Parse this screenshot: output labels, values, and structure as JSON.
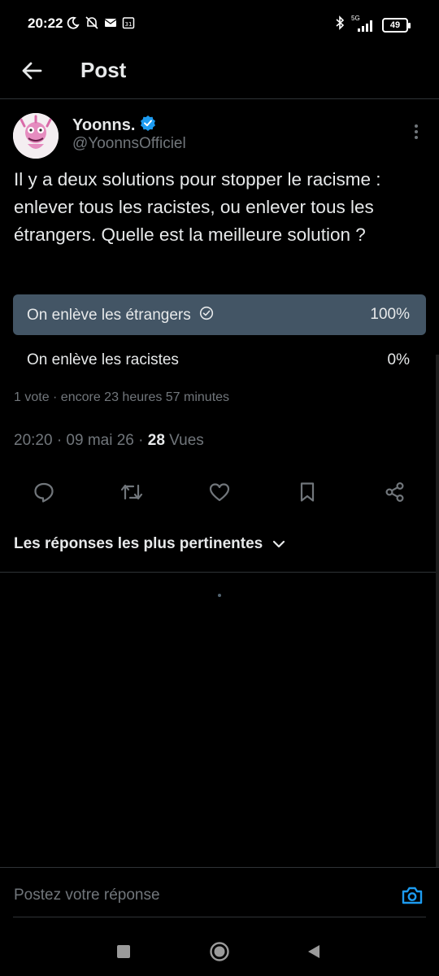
{
  "status_bar": {
    "time": "20:22",
    "network": "5G",
    "battery": "49"
  },
  "header": {
    "title": "Post"
  },
  "author": {
    "name": "Yoonns.",
    "handle": "@YoonnsOfficiel",
    "verified": true
  },
  "tweet": {
    "text": "Il y a deux solutions pour stopper le racisme : enlever tous les racistes, ou enlever tous les étrangers. Quelle est la meilleure solution ?",
    "timestamp": "20:20 · 09 mai 26 · ",
    "views_count": "28",
    "views_label": " Vues"
  },
  "poll": {
    "options": [
      {
        "label": "On enlève les étrangers",
        "percent": "100%",
        "fraction": 1.0,
        "winner": true
      },
      {
        "label": "On enlève les racistes",
        "percent": "0%",
        "fraction": 0.0,
        "winner": false
      }
    ],
    "meta": "1 vote · encore 23 heures 57 minutes"
  },
  "actions": [
    "reply-icon",
    "retweet-icon",
    "like-icon",
    "bookmark-icon",
    "share-icon"
  ],
  "replies": {
    "sort_label": "Les réponses les plus pertinentes"
  },
  "reply_bar": {
    "placeholder": "Postez votre réponse"
  },
  "colors": {
    "background": "#000000",
    "text": "#e7e9ea",
    "secondary_text": "#71767b",
    "poll_fill": "#435565",
    "accent": "#1d9bf0",
    "divider": "#2f3336"
  }
}
